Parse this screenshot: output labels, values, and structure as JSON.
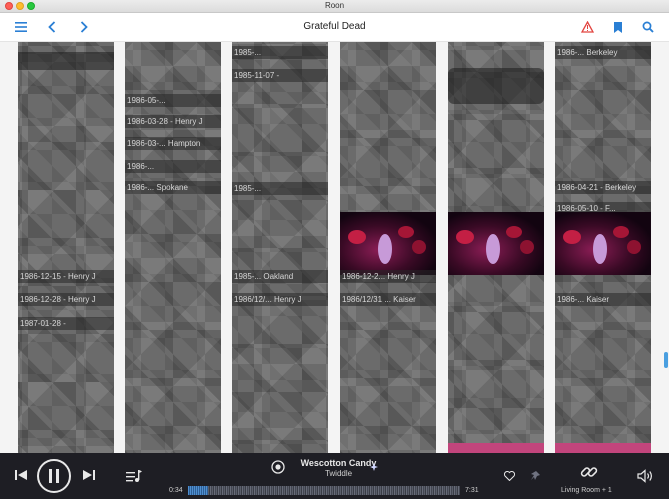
{
  "window": {
    "title": "Roon"
  },
  "toolbar": {
    "page_title": "Grateful Dead",
    "icons": [
      "menu-icon",
      "back-icon",
      "forward-icon",
      "warning-icon",
      "bookmark-icon",
      "search-icon"
    ],
    "accent": "#2a7fd4",
    "warning_color": "#e2433f"
  },
  "grid": {
    "columns": [
      {
        "labels": [
          "1986-12-15 - Henry J",
          "1986-12-28 - Henry J",
          "1987-01-28 -"
        ]
      },
      {
        "labels": [
          "1986-05-...",
          "1986-03-28 - Henry J",
          "1986-03-... Hampton",
          "1986-...",
          "1986-... Spokane"
        ]
      },
      {
        "labels": [
          "1985-...",
          "1985-11-07 -",
          "1985-...",
          "1985-... Oakland",
          "1986/12/... Henry J"
        ]
      },
      {
        "labels": [
          "1986-12-2... Henry J",
          "1986/12/31 ... Kaiser"
        ]
      },
      {
        "labels": []
      },
      {
        "labels": [
          "1986-... Berkeley",
          "1986-04-21 - Berkeley",
          "1986-05-10 - F...",
          "1986-... Kaiser"
        ]
      }
    ]
  },
  "player": {
    "track_title": "Wescotton Candy",
    "artist": "Twiddle",
    "elapsed": "0:34",
    "duration": "7:31",
    "progress_fraction": 0.075,
    "zone": "Living Room + 1"
  }
}
